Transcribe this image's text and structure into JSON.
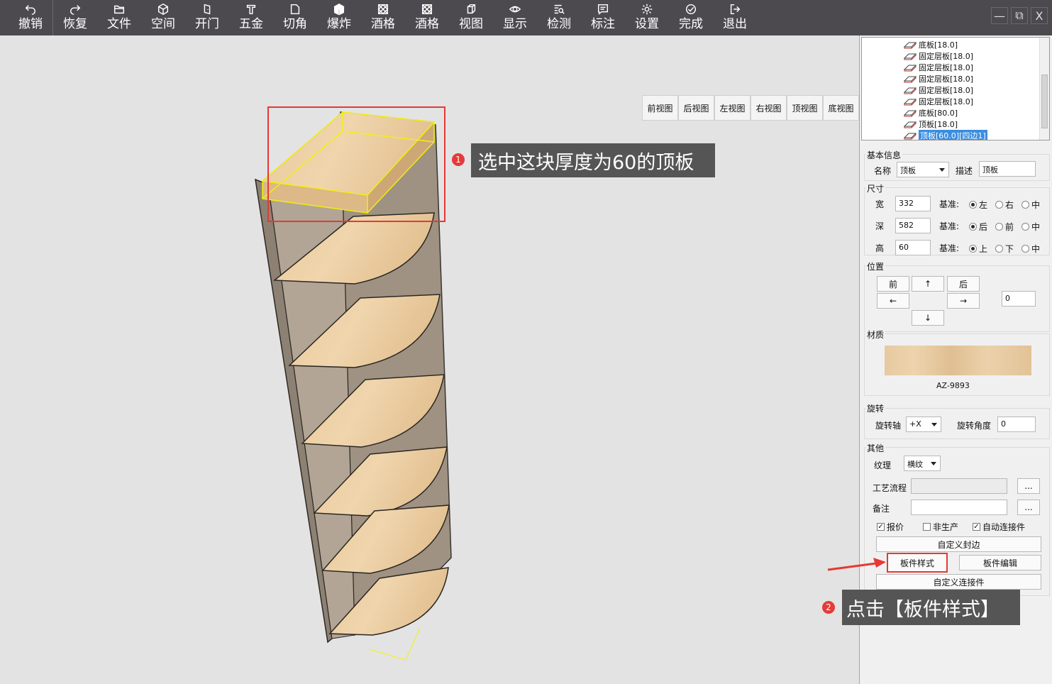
{
  "toolbar": {
    "buttons": [
      {
        "label": "撤销",
        "icon": "undo-icon"
      },
      {
        "label": "恢复",
        "icon": "redo-icon"
      },
      {
        "label": "文件",
        "icon": "folder-icon"
      },
      {
        "label": "空间",
        "icon": "cube-icon"
      },
      {
        "label": "开门",
        "icon": "door-icon"
      },
      {
        "label": "五金",
        "icon": "hardware-icon"
      },
      {
        "label": "切角",
        "icon": "cut-corner-icon"
      },
      {
        "label": "爆炸",
        "icon": "explode-icon"
      },
      {
        "label": "酒格",
        "icon": "wine-grid-icon"
      },
      {
        "label": "酒格",
        "icon": "wine-grid-icon"
      },
      {
        "label": "视图",
        "icon": "view-icon"
      },
      {
        "label": "显示",
        "icon": "eye-icon"
      },
      {
        "label": "检测",
        "icon": "inspect-icon"
      },
      {
        "label": "标注",
        "icon": "annotate-icon"
      },
      {
        "label": "设置",
        "icon": "gear-icon"
      },
      {
        "label": "完成",
        "icon": "check-icon"
      },
      {
        "label": "退出",
        "icon": "exit-icon"
      }
    ],
    "window": {
      "minimize": "—",
      "restore": "⧉",
      "close": "X"
    }
  },
  "view_buttons": [
    "前视图",
    "后视图",
    "左视图",
    "右视图",
    "顶视图",
    "底视图"
  ],
  "callouts": {
    "step1_num": "1",
    "step1_text": "选中这块厚度为60的顶板",
    "step2_num": "2",
    "step2_text": "点击【板件样式】"
  },
  "tree": {
    "items": [
      "底板[18.0]",
      "固定层板[18.0]",
      "固定层板[18.0]",
      "固定层板[18.0]",
      "固定层板[18.0]",
      "固定层板[18.0]",
      "底板[80.0]",
      "顶板[18.0]",
      "顶板[60.0][四边1]"
    ],
    "selected_index": 8
  },
  "panel": {
    "basic": {
      "title": "基本信息",
      "name_label": "名称",
      "name_value": "顶板",
      "desc_label": "描述",
      "desc_value": "顶板"
    },
    "size": {
      "title": "尺寸",
      "base_label": "基准:",
      "rows": [
        {
          "label": "宽",
          "value": "332",
          "options": [
            "左",
            "右",
            "中"
          ],
          "checked": 0
        },
        {
          "label": "深",
          "value": "582",
          "options": [
            "后",
            "前",
            "中"
          ],
          "checked": 0
        },
        {
          "label": "高",
          "value": "60",
          "options": [
            "上",
            "下",
            "中"
          ],
          "checked": 0
        }
      ]
    },
    "position": {
      "title": "位置",
      "front": "前",
      "up": "↑",
      "back": "后",
      "left": "←",
      "right": "→",
      "down": "↓",
      "step_value": "0"
    },
    "material": {
      "title": "材质",
      "code": "AZ-9893"
    },
    "rotation": {
      "title": "旋转",
      "axis_label": "旋转轴",
      "axis_value": "+X",
      "angle_label": "旋转角度",
      "angle_value": "0"
    },
    "other": {
      "title": "其他",
      "grain_label": "纹理",
      "grain_value": "横纹",
      "process_label": "工艺流程",
      "process_btn": "...",
      "remark_label": "备注",
      "remark_btn": "...",
      "checks": [
        {
          "label": "报价",
          "checked": true
        },
        {
          "label": "非生产",
          "checked": false
        },
        {
          "label": "自动连接件",
          "checked": true
        }
      ],
      "custom_edge": "自定义封边",
      "panel_style": "板件样式",
      "panel_edit": "板件编辑",
      "custom_connector": "自定义连接件"
    }
  },
  "colors": {
    "toolbar_bg": "#4d4a4f",
    "highlight_red": "#e53935",
    "callout_bg": "#555555",
    "select_yellow": "#f2f20a"
  }
}
